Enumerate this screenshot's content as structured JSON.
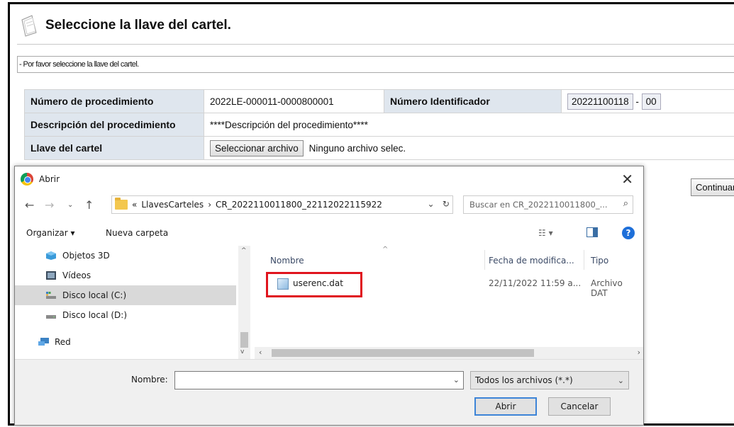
{
  "page": {
    "title": "Seleccione la llave del cartel.",
    "notice": "- Por favor seleccione la llave del cartel.",
    "fields": {
      "numero_procedimiento_label": "Número de procedimiento",
      "numero_procedimiento_value": "2022LE-000011-0000800001",
      "numero_identificador_label": "Número Identificador",
      "numero_identificador_value": "20221100118",
      "numero_identificador_sep": "-",
      "numero_identificador_suffix": "00",
      "descripcion_label": "Descripción del procedimiento",
      "descripcion_value": "****Descripción del procedimiento****",
      "llave_label": "Llave del cartel",
      "file_button": "Seleccionar archivo",
      "file_status": "Ninguno archivo selec."
    },
    "continue_button": "Continuar"
  },
  "dialog": {
    "title": "Abrir",
    "close": "✕",
    "breadcrumb": {
      "prefix": "«",
      "segment1": "LlavesCarteles",
      "separator": "›",
      "segment2": "CR_2022110011800_22112022115922"
    },
    "search_placeholder": "Buscar en CR_2022110011800_...",
    "toolbar": {
      "organizar": "Organizar ▾",
      "nueva_carpeta": "Nueva carpeta"
    },
    "nav_items": [
      {
        "label": "Objetos 3D",
        "icon": "objects-3d-icon"
      },
      {
        "label": "Vídeos",
        "icon": "videos-icon"
      },
      {
        "label": "Disco local (C:)",
        "icon": "drive-c-icon"
      },
      {
        "label": "Disco local (D:)",
        "icon": "drive-d-icon"
      },
      {
        "label": "Red",
        "icon": "network-icon"
      }
    ],
    "columns": {
      "nombre": "Nombre",
      "fecha": "Fecha de modifica...",
      "tipo": "Tipo"
    },
    "files": [
      {
        "name": "userenc.dat",
        "date": "22/11/2022 11:59 a...",
        "type": "Archivo DAT"
      }
    ],
    "nombre_label": "Nombre:",
    "nombre_value": "",
    "file_type": "Todos los archivos (*.*)",
    "open_button": "Abrir",
    "cancel_button": "Cancelar"
  },
  "colors": {
    "label_bg": "#dfe6ee",
    "highlight": "#e0141e",
    "selected_nav": "#d9d9d9"
  }
}
